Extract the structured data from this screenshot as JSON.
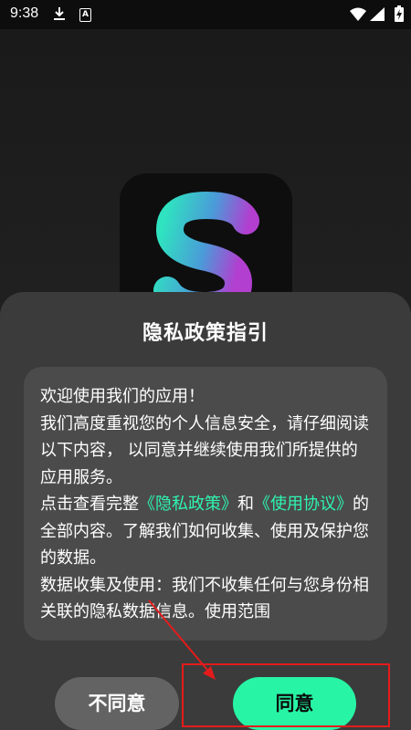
{
  "status_bar": {
    "time": "9:38",
    "icons": [
      "download-icon",
      "app-notification-icon",
      "wifi-icon",
      "signal-icon",
      "battery-charging-icon"
    ],
    "app_icon_letter": "A"
  },
  "dialog": {
    "title": "隐私政策指引",
    "paragraphs": {
      "p1": "欢迎使用我们的应用！",
      "p2": "我们高度重视您的个人信息安全，请仔细阅读以下内容， 以同意并继续使用我们所提供的应用服务。",
      "p3_prefix": "点击查看完整",
      "privacy_link": "《隐私政策》",
      "p3_and": "和",
      "terms_link": "《使用协议》",
      "p3_suffix": "的全部内容。了解我们如何收集、使用及保护您的数据。",
      "p4": "数据收集及使用：我们不收集任何与您身份相关联的隐私数据信息。使用范围"
    },
    "buttons": {
      "decline": "不同意",
      "agree": "同意"
    }
  },
  "colors": {
    "accent": "#27f5a5",
    "link": "#2ef5b0",
    "annotation": "#e41b1b",
    "sheet_bg": "#3b3b3b",
    "content_bg": "#4b4b4b"
  }
}
